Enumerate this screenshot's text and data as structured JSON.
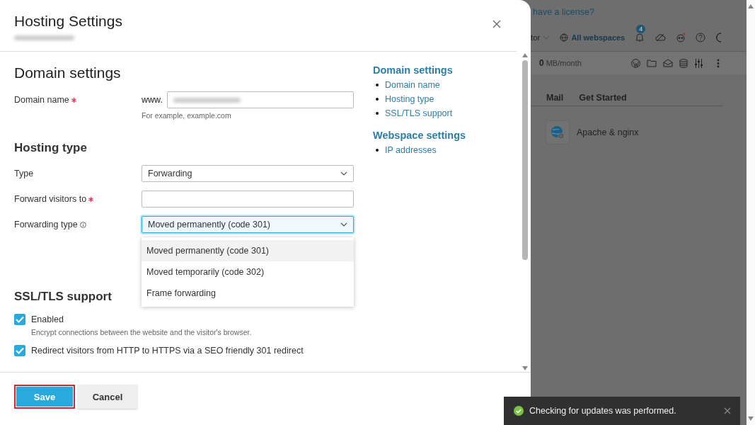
{
  "dialog": {
    "title": "Hosting Settings",
    "domain_settings": {
      "heading": "Domain settings",
      "label": "Domain name",
      "required": true,
      "prefix": "www.",
      "hint": "For example, example.com"
    },
    "hosting_type": {
      "heading": "Hosting type",
      "fields": [
        {
          "kind": "select",
          "label": "Type",
          "required": false,
          "info": false,
          "value": "Forwarding",
          "focused": false
        },
        {
          "kind": "input",
          "label": "Forward visitors to",
          "required": true,
          "info": false,
          "focused": false
        },
        {
          "kind": "select",
          "label": "Forwarding type",
          "required": false,
          "info": true,
          "value": "Moved permanently (code 301)",
          "focused": true,
          "expanded": true,
          "options": [
            {
              "label": "Moved permanently (code 301)",
              "selected": true
            },
            {
              "label": "Moved temporarily (code 302)",
              "selected": false
            },
            {
              "label": "Frame forwarding",
              "selected": false
            }
          ]
        }
      ]
    },
    "ssl": {
      "heading": "SSL/TLS support",
      "checkboxes": [
        {
          "label": "Enabled",
          "checked": true,
          "description": "Encrypt connections between the website and the visitor's browser."
        },
        {
          "label": "Redirect visitors from HTTP to HTTPS via a SEO friendly 301 redirect",
          "checked": true
        }
      ]
    },
    "nav": [
      {
        "heading": "Domain settings",
        "items": [
          "Domain name",
          "Hosting type",
          "SSL/TLS support"
        ]
      },
      {
        "heading": "Webspace settings",
        "items": [
          "IP addresses"
        ]
      }
    ],
    "buttons": [
      {
        "label": "Save",
        "kind": "primary",
        "highlighted": true
      },
      {
        "label": "Cancel",
        "kind": "secondary",
        "highlighted": false
      }
    ]
  },
  "background": {
    "license_link": "have a license?",
    "role_menu": "tor",
    "webspaces": "All webspaces",
    "notification_count": "4",
    "traffic_value": "0",
    "traffic_unit": "MB/month",
    "tabs": [
      "Mail",
      "Get Started"
    ],
    "server": "Apache & nginx"
  },
  "toast": {
    "message": "Checking for updates was performed."
  }
}
